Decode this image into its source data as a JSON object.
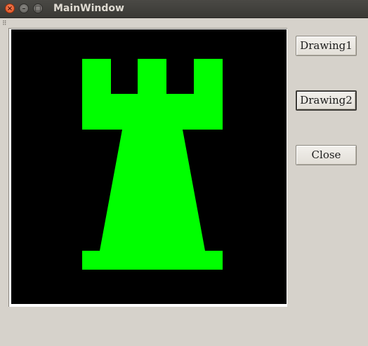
{
  "window": {
    "title": "MainWindow",
    "controls": [
      "close-icon",
      "minimize-icon",
      "maximize-icon"
    ]
  },
  "toolbar": {
    "grip": "⠿"
  },
  "canvas": {
    "background": "#000000",
    "shape_color": "#00ff00",
    "shape": "rook-icon"
  },
  "buttons": {
    "drawing1": "Drawing1",
    "drawing2": "Drawing2",
    "close": "Close"
  }
}
